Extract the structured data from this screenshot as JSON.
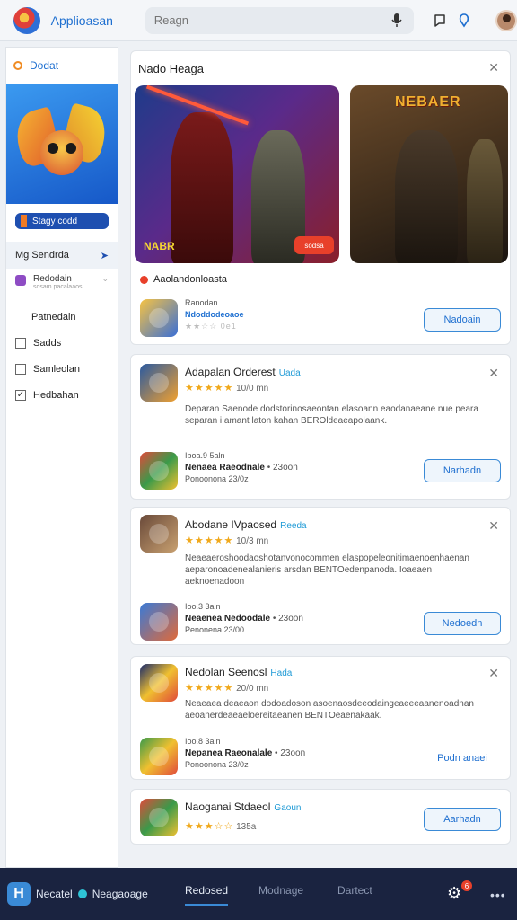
{
  "header": {
    "app_title": "Applioasan",
    "search_placeholder": "Reagn",
    "icons": [
      "logo-icon",
      "microphone-icon",
      "chat-icon",
      "notification-icon",
      "avatar"
    ]
  },
  "sidebar": {
    "heading": "Dodat",
    "banner_button": "Stagy codd",
    "active_item": "Mg Sendrda",
    "sub_item": {
      "label": "Redodain",
      "caption": "sosam pacalaaos"
    },
    "plain_item": "Patnedaln",
    "checkbox_items": [
      {
        "label": "Sadds",
        "checked": false
      },
      {
        "label": "Samleolan",
        "checked": false
      },
      {
        "label": "Hedbahan",
        "checked": true
      }
    ]
  },
  "hero": {
    "title": "Nado Heaga",
    "image1_badge": "NABR",
    "image1_button": "sodsa",
    "image2_logo": "NEBAER",
    "featured_label": "Aaolandonloasta",
    "featured_app": {
      "line1": "Ranodan",
      "line2": "Ndoddodeoaoe",
      "rating": "★★☆☆ 0e1",
      "button": "Nadoain"
    }
  },
  "cards": [
    {
      "title": "Adapalan Orderest",
      "tag": "Uada",
      "stars": "★★★★★",
      "rating_text": "10/0 mn",
      "description": "Deparan Saenode dodstorinosaeontan elasoann eaodanaeane nue peara separan i amant laton kahan BEROldeaeapolaank.",
      "sub_meta": "Iboa.9 5aln",
      "sub_title": "Nenaea Raeodnale",
      "sub_count": "• 23oon",
      "sub_caption": "Ponoonona 23/0z",
      "button": "Narhadn"
    },
    {
      "title": "Abodane IVpaosed",
      "tag": "Reeda",
      "stars": "★★★★★",
      "rating_text": "10/3 mn",
      "description": "Neaeaeroshoodaoshotanvonocommen elaspopeleonitimaenoenhaenan aeparonoadenealanieris arsdan BENTOedenpanoda. Ioaeaen aeknoenadoon",
      "sub_meta": "Ioo.3 3aln",
      "sub_title": "Neaenea Nedoodale",
      "sub_count": "• 23oon",
      "sub_caption": "Penonena 23/00",
      "button": "Nedoedn"
    },
    {
      "title": "Nedolan Seenosl",
      "tag": "Hada",
      "stars": "★★★★★",
      "rating_text": "20/0 mn",
      "description": "Neaeaea deaeaon dodoadoson asoenaosdeeodaingeaeeeaanenoadnan aeoanerdeaeaeloereitaeanen BENTOeaenakaak.",
      "sub_meta": "Ioo.8 3aln",
      "sub_title": "Nepanea Raeonalale",
      "sub_count": "• 23oon",
      "sub_caption": "Ponoonona 23/0z",
      "button": "Podn anaei"
    },
    {
      "title": "Naoganai Stdaeol",
      "tag": "Gaoun",
      "stars": "★★★☆☆",
      "rating_text": "135a",
      "button": "Aarhadn"
    }
  ],
  "bottom_bar": {
    "logo_letter": "H",
    "brand1": "Necatel",
    "brand2": "Neagaoage",
    "tabs": [
      "Redosed",
      "Modnage",
      "Dartect"
    ],
    "badge_count": "6",
    "more": "•••"
  },
  "colors": {
    "accent": "#1e6fd0",
    "bottom_bar": "#1a2340",
    "star": "#f0a81a",
    "hero_button": "#e8402a"
  }
}
